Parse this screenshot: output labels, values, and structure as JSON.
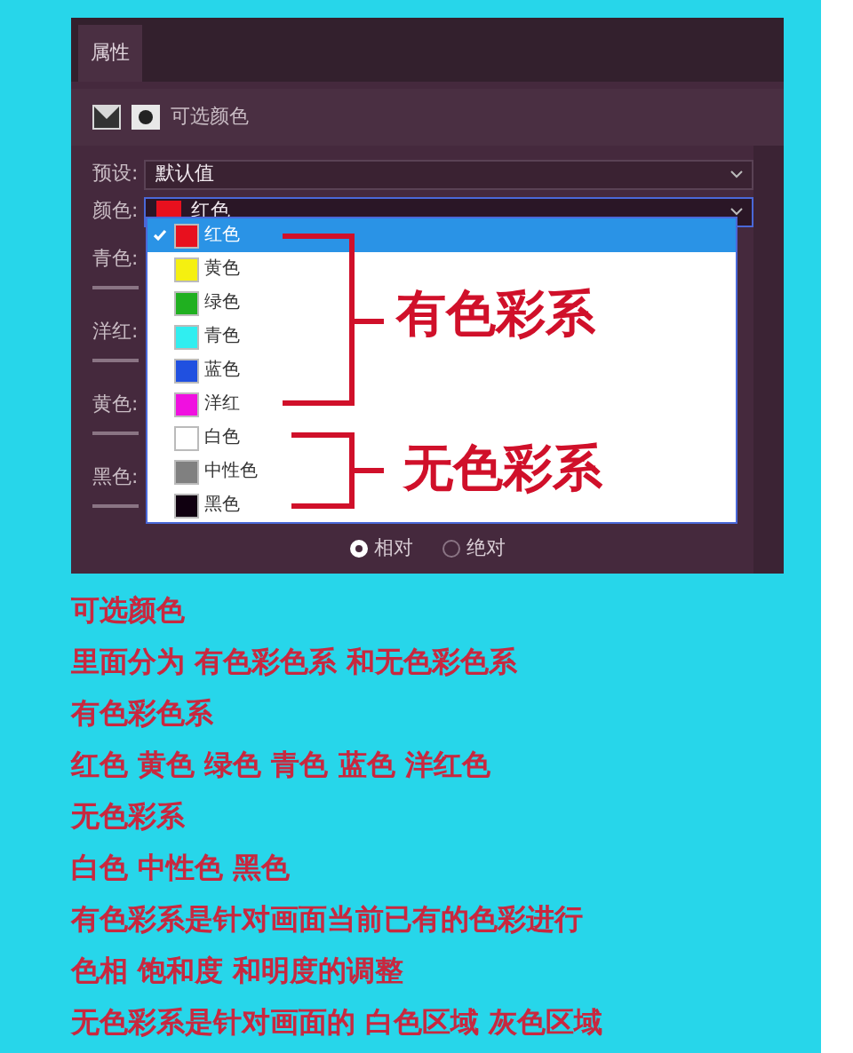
{
  "panel": {
    "tab": "属性",
    "title": "可选颜色",
    "preset": {
      "label": "预设:",
      "value": "默认值"
    },
    "color_field": {
      "label": "颜色:",
      "value": "红色",
      "color": "#e8101e"
    },
    "sliders": [
      {
        "label": "青色:"
      },
      {
        "label": "洋红:"
      },
      {
        "label": "黄色:"
      },
      {
        "label": "黑色:"
      }
    ],
    "dropdown_options": [
      {
        "label": "红色",
        "color": "#e8101e",
        "selected": true
      },
      {
        "label": "黄色",
        "color": "#f5f010",
        "selected": false
      },
      {
        "label": "绿色",
        "color": "#20b020",
        "selected": false
      },
      {
        "label": "青色",
        "color": "#30eef0",
        "selected": false
      },
      {
        "label": "蓝色",
        "color": "#2050e0",
        "selected": false
      },
      {
        "label": "洋红",
        "color": "#f010e0",
        "selected": false
      },
      {
        "label": "白色",
        "color": "#ffffff",
        "selected": false
      },
      {
        "label": "中性色",
        "color": "#808080",
        "selected": false
      },
      {
        "label": "黑色",
        "color": "#100010",
        "selected": false
      }
    ],
    "annotations": [
      {
        "label": "有色彩系"
      },
      {
        "label": "无色彩系"
      }
    ],
    "radios": [
      {
        "label": "相对",
        "selected": true
      },
      {
        "label": "绝对",
        "selected": false
      }
    ]
  },
  "notes": [
    "可选颜色",
    "里面分为 有色彩色系 和无色彩色系",
    "有色彩色系",
    "红色 黄色 绿色 青色 蓝色 洋红色",
    "无色彩系",
    "白色 中性色 黑色",
    "有色彩系是针对画面当前已有的色彩进行",
    "色相 饱和度 和明度的调整",
    "无色彩系是针对画面的 白色区域 灰色区域"
  ]
}
